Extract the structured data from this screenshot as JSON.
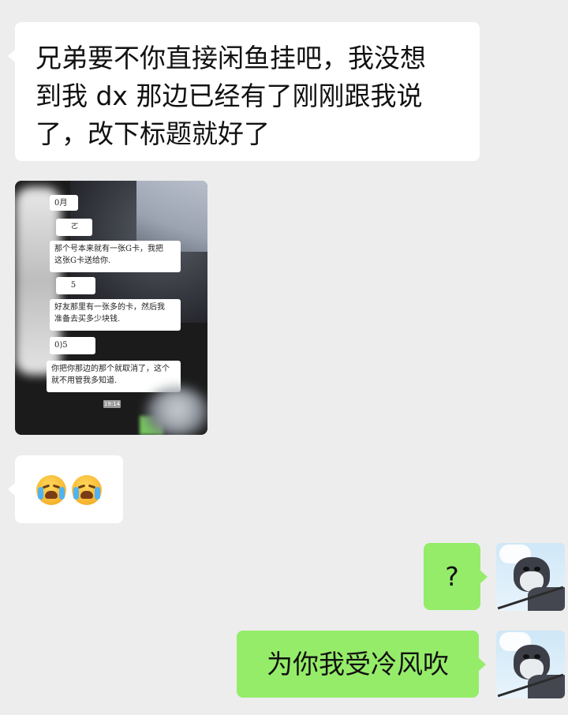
{
  "messages": {
    "incoming_text": {
      "lines": [
        "兄弟要不你直接闲鱼挂吧，我没想",
        "到我 dx 那边已经有了刚刚跟我说",
        "了，改下标题就好了"
      ]
    },
    "image_message": {
      "cards": [
        "0月",
        "    ㄛ",
        "那个号本来就有一张G卡，我把",
        "这张G卡送给你.",
        "    5",
        "好友那里有一张多的卡，然后我",
        "准备去买多少块钱.",
        "0)5",
        "你把你那边的那个就取消了，这个",
        "就不用管我多知道."
      ],
      "time": "19:14"
    },
    "incoming_emoji": {
      "emoji_names": [
        "loudly-crying-face-icon",
        "loudly-crying-face-icon"
      ]
    },
    "outgoing_1": {
      "text": "?"
    },
    "outgoing_2": {
      "text": "为你我受冷风吹"
    }
  },
  "colors": {
    "background": "#ededed",
    "incoming_bubble": "#ffffff",
    "outgoing_bubble": "#95ec69"
  },
  "avatar": {
    "icon": "tom-cat-avatar-icon"
  }
}
